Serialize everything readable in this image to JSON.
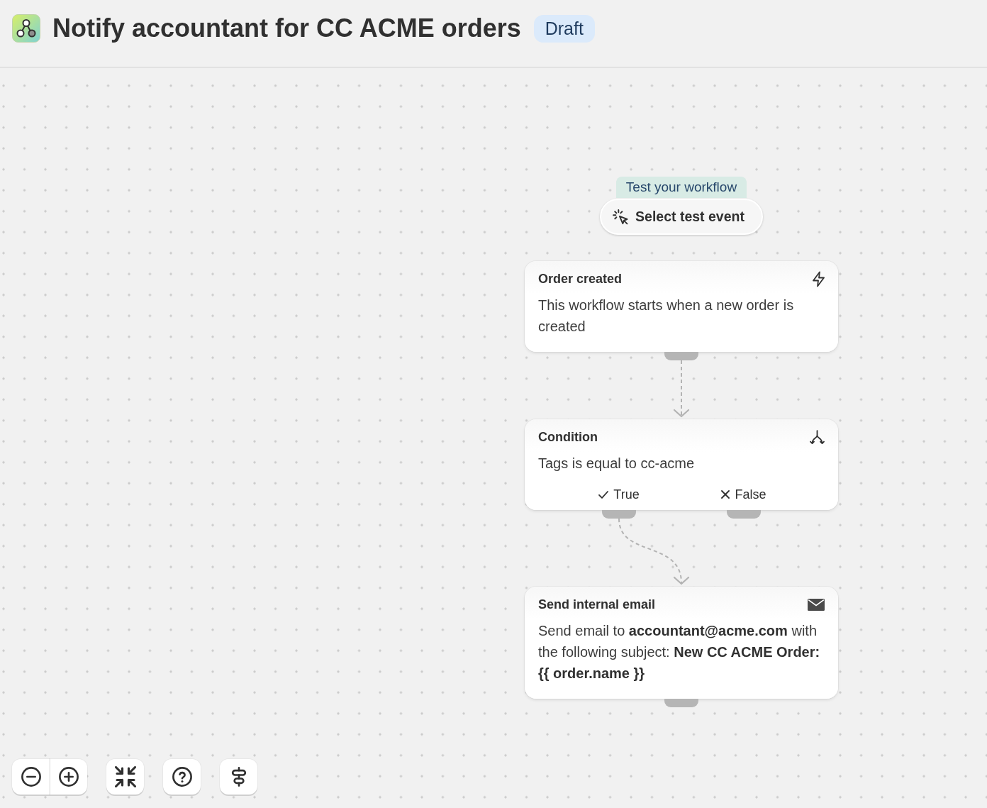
{
  "header": {
    "title": "Notify accountant for CC ACME orders",
    "status": "Draft"
  },
  "test_panel": {
    "label": "Test your workflow",
    "button": "Select test event"
  },
  "nodes": [
    {
      "kind": "trigger",
      "title": "Order created",
      "description": "This workflow starts when a new order is created"
    },
    {
      "kind": "condition",
      "title": "Condition",
      "description": "Tags is equal to cc-acme",
      "branches": [
        {
          "kind": "true",
          "label": "True"
        },
        {
          "kind": "false",
          "label": "False"
        }
      ]
    },
    {
      "kind": "action",
      "title": "Send internal email",
      "description": "Send email to **accountant@acme.com** with the following subject: **New CC ACME Order: {{ order.name }}**"
    }
  ]
}
